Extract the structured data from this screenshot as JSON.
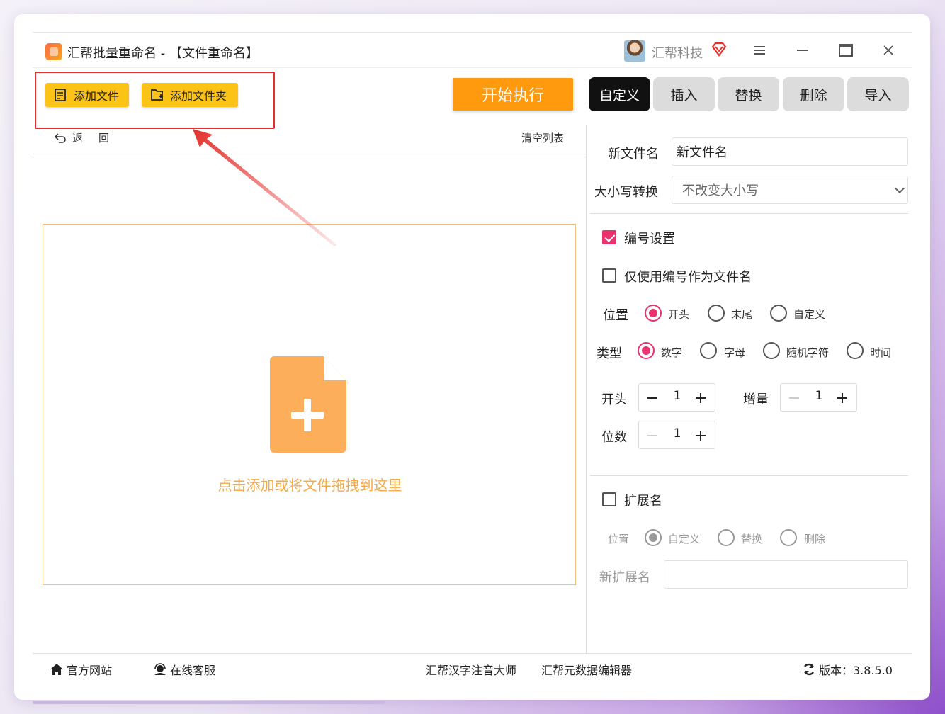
{
  "window": {
    "title": "汇帮批量重命名 - 【文件重命名】",
    "brand": "汇帮科技"
  },
  "toolbar": {
    "add_file": "添加文件",
    "add_folder": "添加文件夹",
    "start": "开始执行",
    "tabs": [
      "自定义",
      "插入",
      "替换",
      "删除",
      "导入"
    ],
    "active_tab": "自定义"
  },
  "file_list": {
    "back": "返",
    "back2": "回",
    "clear": "清空列表",
    "drop_hint": "点击添加或将文件拖拽到这里"
  },
  "settings": {
    "new_name_label": "新文件名",
    "new_name_value": "新文件名",
    "case_label": "大小写转换",
    "case_value": "不改变大小写",
    "numbering_label": "编号设置",
    "numbering_checked": true,
    "only_number_label": "仅使用编号作为文件名",
    "only_number_checked": false,
    "position_label": "位置",
    "position_options": [
      "开头",
      "末尾",
      "自定义"
    ],
    "position_selected": "开头",
    "type_label": "类型",
    "type_options": [
      "数字",
      "字母",
      "随机字符",
      "时间"
    ],
    "type_selected": "数字",
    "start_label": "开头",
    "start_value": "1",
    "increment_label": "增量",
    "increment_value": "1",
    "digits_label": "位数",
    "digits_value": "1",
    "ext_label": "扩展名",
    "ext_checked": false,
    "ext_position_label": "位置",
    "ext_options": [
      "自定义",
      "替换",
      "删除"
    ],
    "ext_selected": "自定义",
    "new_ext_label": "新扩展名",
    "new_ext_value": ""
  },
  "footer": {
    "website": "官方网站",
    "service": "在线客服",
    "link1": "汇帮汉字注音大师",
    "link2": "汇帮元数据编辑器",
    "version": "版本：3.8.5.0"
  },
  "colors": {
    "accent_yellow": "#fcc317",
    "start_orange": "#ff9a0e",
    "check_pink": "#e8336e",
    "highlight_red": "#e3312c"
  }
}
